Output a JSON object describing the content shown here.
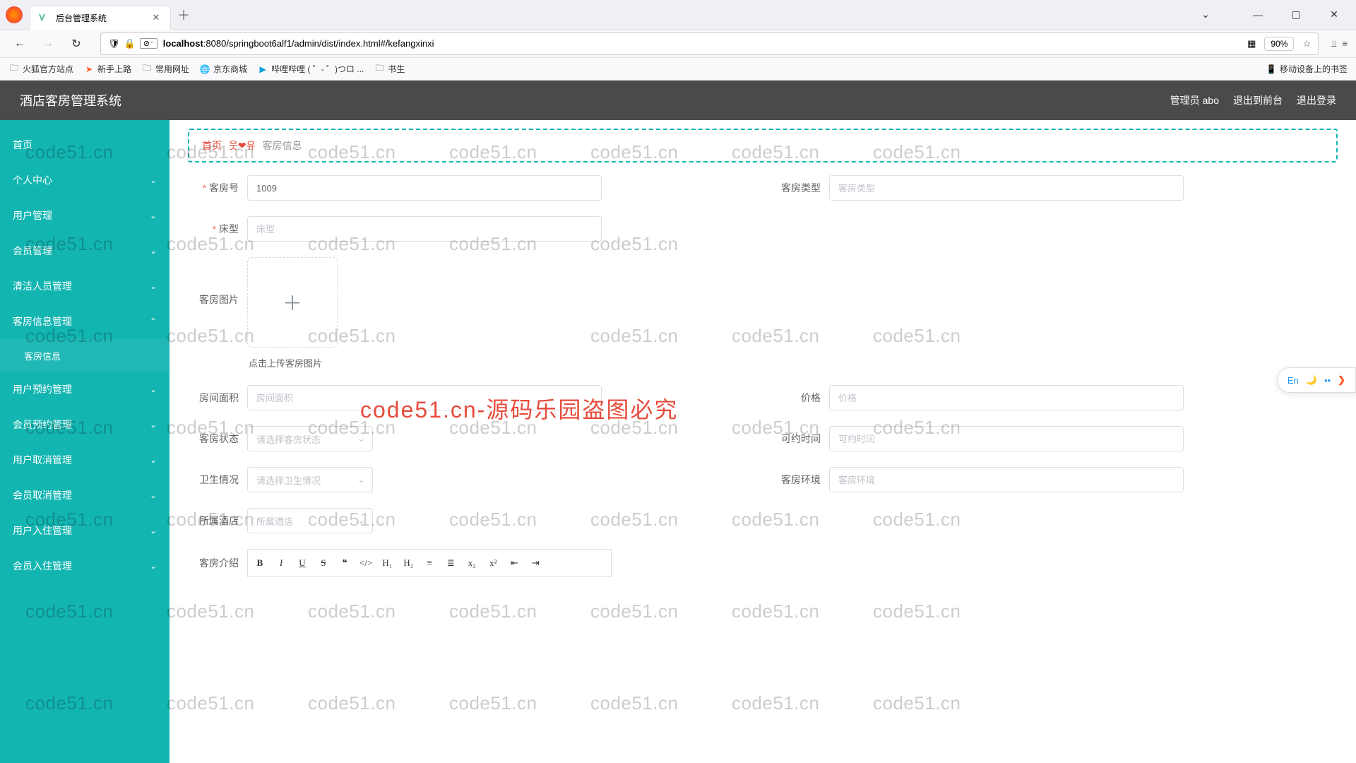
{
  "browser": {
    "tab_title": "后台管理系统",
    "url_host": "localhost",
    "url_rest": ":8080/springboot6alf1/admin/dist/index.html#/kefangxinxi",
    "zoom": "90%",
    "bookmarks": [
      {
        "label": "火狐官方站点"
      },
      {
        "label": "新手上路"
      },
      {
        "label": "常用网址"
      },
      {
        "label": "京东商城"
      },
      {
        "label": "哔哩哔哩 ( ゜- ゜)つロ ..."
      },
      {
        "label": "书生"
      }
    ],
    "mobile_bookmarks": "移动设备上的书签"
  },
  "header": {
    "title": "酒店客房管理系统",
    "user": "管理员 abo",
    "front_link": "退出到前台",
    "logout": "退出登录"
  },
  "sidebar": {
    "items": [
      {
        "label": "首页",
        "expandable": false
      },
      {
        "label": "个人中心",
        "expandable": true
      },
      {
        "label": "用户管理",
        "expandable": true
      },
      {
        "label": "会员管理",
        "expandable": true
      },
      {
        "label": "清洁人员管理",
        "expandable": true
      },
      {
        "label": "客房信息管理",
        "expandable": true,
        "open": true,
        "children": [
          {
            "label": "客房信息"
          }
        ]
      },
      {
        "label": "用户预约管理",
        "expandable": true
      },
      {
        "label": "会员预约管理",
        "expandable": true
      },
      {
        "label": "用户取消管理",
        "expandable": true
      },
      {
        "label": "会员取消管理",
        "expandable": true
      },
      {
        "label": "用户入住管理",
        "expandable": true
      },
      {
        "label": "会员入住管理",
        "expandable": true
      }
    ]
  },
  "breadcrumb": {
    "home": "首页",
    "sep": "웃❤유",
    "current": "客房信息"
  },
  "form": {
    "room_no_label": "客房号",
    "room_no_value": "1009",
    "room_type_label": "客房类型",
    "room_type_ph": "客房类型",
    "bed_label": "床型",
    "bed_ph": "床型",
    "img_label": "客房图片",
    "upload_hint": "点击上传客房图片",
    "area_label": "房间面积",
    "area_ph": "房间面积",
    "price_label": "价格",
    "price_ph": "价格",
    "status_label": "客房状态",
    "status_ph": "请选择客房状态",
    "avail_label": "可约时间",
    "avail_ph": "可约时间",
    "clean_label": "卫生情况",
    "clean_ph": "请选择卫生情况",
    "env_label": "客房环境",
    "env_ph": "客房环境",
    "hotel_label": "所属酒店",
    "hotel_ph": "所属酒店",
    "intro_label": "客房介绍"
  },
  "watermark": {
    "text": "code51.cn",
    "red": "code51.cn-源码乐园盗图必究"
  },
  "float": {
    "en": "En"
  }
}
